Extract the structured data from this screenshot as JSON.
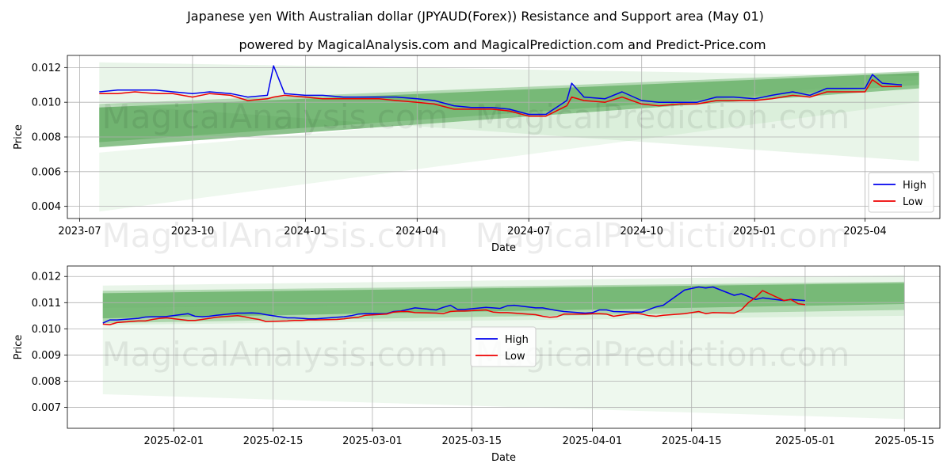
{
  "title": "Japanese yen With Australian dollar (JPYAUD(Forex)) Resistance and Support area (May 01)",
  "subtitle": "powered by MagicalAnalysis.com and MagicalPrediction.com and Predict-Price.com",
  "watermarks": [
    "MagicalAnalysis.com",
    "MagicalPrediction.com"
  ],
  "colors": {
    "high": "#0000ee",
    "low": "#ee0000",
    "band_dark": "#3f9a3f",
    "band_light": "#8fcf8f",
    "grid": "#b0b0b0"
  },
  "chart_data": [
    {
      "type": "line",
      "xlabel": "Date",
      "ylabel": "Price",
      "x_start": "2023-07-17",
      "x_end": "2025-05-15",
      "xlim": [
        "2023-06-21",
        "2025-06-01"
      ],
      "ylim": [
        0.0033,
        0.0127
      ],
      "xticks": [
        "2023-07",
        "2023-10",
        "2024-01",
        "2024-04",
        "2024-07",
        "2024-10",
        "2025-01",
        "2025-04"
      ],
      "yticks": [
        "0.004",
        "0.006",
        "0.008",
        "0.010",
        "0.012"
      ],
      "legend": [
        "High",
        "Low"
      ],
      "legend_position": "lower-right",
      "grid": true,
      "series": [
        {
          "name": "High",
          "x": [
            "2023-07-17",
            "2023-08-01",
            "2023-08-15",
            "2023-09-01",
            "2023-09-15",
            "2023-10-01",
            "2023-10-15",
            "2023-11-01",
            "2023-11-15",
            "2023-12-01",
            "2023-12-06",
            "2023-12-15",
            "2024-01-01",
            "2024-01-15",
            "2024-02-01",
            "2024-02-15",
            "2024-03-01",
            "2024-03-15",
            "2024-04-01",
            "2024-04-15",
            "2024-05-01",
            "2024-05-15",
            "2024-06-01",
            "2024-06-15",
            "2024-07-01",
            "2024-07-15",
            "2024-08-01",
            "2024-08-05",
            "2024-08-15",
            "2024-09-01",
            "2024-09-15",
            "2024-10-01",
            "2024-10-15",
            "2024-11-01",
            "2024-11-15",
            "2024-12-01",
            "2024-12-15",
            "2025-01-01",
            "2025-01-15",
            "2025-02-01",
            "2025-02-15",
            "2025-03-01",
            "2025-03-15",
            "2025-04-01",
            "2025-04-07",
            "2025-04-15",
            "2025-05-01"
          ],
          "values": [
            0.0106,
            0.0107,
            0.0107,
            0.0107,
            0.0106,
            0.0105,
            0.0106,
            0.0105,
            0.0103,
            0.0104,
            0.0121,
            0.0105,
            0.0104,
            0.0104,
            0.0103,
            0.0103,
            0.0103,
            0.0103,
            0.0102,
            0.0101,
            0.0098,
            0.0097,
            0.0097,
            0.0096,
            0.0093,
            0.0093,
            0.0101,
            0.0111,
            0.0103,
            0.0102,
            0.0106,
            0.0101,
            0.01,
            0.01,
            0.01,
            0.0103,
            0.0103,
            0.0102,
            0.0104,
            0.0106,
            0.0104,
            0.0108,
            0.0108,
            0.0108,
            0.0116,
            0.0111,
            0.011
          ]
        },
        {
          "name": "Low",
          "x": [
            "2023-07-17",
            "2023-08-01",
            "2023-08-15",
            "2023-09-01",
            "2023-09-15",
            "2023-10-01",
            "2023-10-15",
            "2023-11-01",
            "2023-11-15",
            "2023-12-01",
            "2023-12-06",
            "2023-12-15",
            "2024-01-01",
            "2024-01-15",
            "2024-02-01",
            "2024-02-15",
            "2024-03-01",
            "2024-03-15",
            "2024-04-01",
            "2024-04-15",
            "2024-05-01",
            "2024-05-15",
            "2024-06-01",
            "2024-06-15",
            "2024-07-01",
            "2024-07-15",
            "2024-08-01",
            "2024-08-05",
            "2024-08-15",
            "2024-09-01",
            "2024-09-15",
            "2024-10-01",
            "2024-10-15",
            "2024-11-01",
            "2024-11-15",
            "2024-12-01",
            "2024-12-15",
            "2025-01-01",
            "2025-01-15",
            "2025-02-01",
            "2025-02-15",
            "2025-03-01",
            "2025-03-15",
            "2025-04-01",
            "2025-04-07",
            "2025-04-15",
            "2025-05-01"
          ],
          "values": [
            0.0105,
            0.0105,
            0.0106,
            0.0105,
            0.0105,
            0.0103,
            0.0105,
            0.0104,
            0.0101,
            0.0102,
            0.0103,
            0.0104,
            0.0103,
            0.0102,
            0.0102,
            0.0102,
            0.0102,
            0.0101,
            0.01,
            0.0099,
            0.0096,
            0.0096,
            0.0096,
            0.0095,
            0.0092,
            0.0092,
            0.0098,
            0.0103,
            0.0101,
            0.01,
            0.0103,
            0.0099,
            0.0098,
            0.0099,
            0.0099,
            0.0101,
            0.0101,
            0.0101,
            0.0102,
            0.0104,
            0.0103,
            0.0106,
            0.0106,
            0.0106,
            0.0113,
            0.0109,
            0.0109
          ]
        }
      ],
      "bands": [
        {
          "opacity": 0.6,
          "x": [
            "2023-07-17",
            "2025-05-15"
          ],
          "upper": [
            0.0097,
            0.0117
          ],
          "lower": [
            0.0074,
            0.0108
          ]
        },
        {
          "opacity": 0.35,
          "x": [
            "2023-07-17",
            "2025-05-15"
          ],
          "upper": [
            0.0099,
            0.0118
          ],
          "lower": [
            0.0077,
            0.011
          ]
        },
        {
          "opacity": 0.2,
          "x": [
            "2023-07-17",
            "2025-05-15"
          ],
          "upper": [
            0.0123,
            0.0115
          ],
          "lower": [
            0.0099,
            0.0066
          ]
        },
        {
          "opacity": 0.15,
          "x": [
            "2023-07-17",
            "2025-05-15"
          ],
          "upper": [
            0.0071,
            0.0113
          ],
          "lower": [
            0.0037,
            0.01
          ]
        }
      ]
    },
    {
      "type": "line",
      "xlabel": "Date",
      "ylabel": "Price",
      "x_start": "2025-01-22",
      "x_end": "2025-05-15",
      "xlim": [
        "2025-01-17",
        "2025-05-20"
      ],
      "ylim": [
        0.0062,
        0.0124
      ],
      "xticks": [
        "2025-02-01",
        "2025-02-15",
        "2025-03-01",
        "2025-03-15",
        "2025-04-01",
        "2025-04-15",
        "2025-05-01",
        "2025-05-15"
      ],
      "yticks": [
        "0.007",
        "0.008",
        "0.009",
        "0.010",
        "0.011",
        "0.012"
      ],
      "legend": [
        "High",
        "Low"
      ],
      "legend_position": "center",
      "grid": true,
      "series": [
        {
          "name": "High",
          "x": [
            "2025-01-22",
            "2025-01-23",
            "2025-01-24",
            "2025-01-27",
            "2025-01-28",
            "2025-01-29",
            "2025-01-30",
            "2025-01-31",
            "2025-02-03",
            "2025-02-04",
            "2025-02-05",
            "2025-02-06",
            "2025-02-07",
            "2025-02-10",
            "2025-02-11",
            "2025-02-12",
            "2025-02-13",
            "2025-02-14",
            "2025-02-17",
            "2025-02-18",
            "2025-02-19",
            "2025-02-20",
            "2025-02-21",
            "2025-02-24",
            "2025-02-25",
            "2025-02-26",
            "2025-02-27",
            "2025-02-28",
            "2025-03-03",
            "2025-03-04",
            "2025-03-05",
            "2025-03-06",
            "2025-03-07",
            "2025-03-10",
            "2025-03-11",
            "2025-03-12",
            "2025-03-13",
            "2025-03-14",
            "2025-03-17",
            "2025-03-18",
            "2025-03-19",
            "2025-03-20",
            "2025-03-21",
            "2025-03-24",
            "2025-03-25",
            "2025-03-26",
            "2025-03-27",
            "2025-03-28",
            "2025-03-31",
            "2025-04-01",
            "2025-04-02",
            "2025-04-03",
            "2025-04-04",
            "2025-04-07",
            "2025-04-08",
            "2025-04-09",
            "2025-04-10",
            "2025-04-11",
            "2025-04-14",
            "2025-04-15",
            "2025-04-16",
            "2025-04-17",
            "2025-04-18",
            "2025-04-21",
            "2025-04-22",
            "2025-04-23",
            "2025-04-24",
            "2025-04-25",
            "2025-04-28",
            "2025-04-29",
            "2025-04-30",
            "2025-05-01"
          ],
          "values": [
            0.01022,
            0.01034,
            0.01034,
            0.0104,
            0.01045,
            0.01046,
            0.01046,
            0.01047,
            0.01058,
            0.01048,
            0.01046,
            0.01048,
            0.01052,
            0.0106,
            0.0106,
            0.01061,
            0.01059,
            0.01054,
            0.01042,
            0.01042,
            0.0104,
            0.01038,
            0.01038,
            0.01044,
            0.01046,
            0.0105,
            0.01056,
            0.01058,
            0.01058,
            0.01066,
            0.01068,
            0.01074,
            0.0108,
            0.01072,
            0.01082,
            0.0109,
            0.01074,
            0.01074,
            0.01082,
            0.0108,
            0.01078,
            0.01088,
            0.0109,
            0.0108,
            0.0108,
            0.01075,
            0.0107,
            0.01066,
            0.0106,
            0.01062,
            0.01072,
            0.01072,
            0.01066,
            0.01064,
            0.01064,
            0.01074,
            0.01084,
            0.0109,
            0.01148,
            0.01154,
            0.0116,
            0.01156,
            0.0116,
            0.01128,
            0.01134,
            0.01124,
            0.01112,
            0.01118,
            0.01108,
            0.01112,
            0.0111,
            0.01108
          ]
        },
        {
          "name": "Low",
          "x": [
            "2025-01-22",
            "2025-01-23",
            "2025-01-24",
            "2025-01-27",
            "2025-01-28",
            "2025-01-29",
            "2025-01-30",
            "2025-01-31",
            "2025-02-03",
            "2025-02-04",
            "2025-02-05",
            "2025-02-06",
            "2025-02-07",
            "2025-02-10",
            "2025-02-11",
            "2025-02-12",
            "2025-02-13",
            "2025-02-14",
            "2025-02-17",
            "2025-02-18",
            "2025-02-19",
            "2025-02-20",
            "2025-02-21",
            "2025-02-24",
            "2025-02-25",
            "2025-02-26",
            "2025-02-27",
            "2025-02-28",
            "2025-03-03",
            "2025-03-04",
            "2025-03-05",
            "2025-03-06",
            "2025-03-07",
            "2025-03-10",
            "2025-03-11",
            "2025-03-12",
            "2025-03-13",
            "2025-03-14",
            "2025-03-17",
            "2025-03-18",
            "2025-03-19",
            "2025-03-20",
            "2025-03-21",
            "2025-03-24",
            "2025-03-25",
            "2025-03-26",
            "2025-03-27",
            "2025-03-28",
            "2025-03-31",
            "2025-04-01",
            "2025-04-02",
            "2025-04-03",
            "2025-04-04",
            "2025-04-07",
            "2025-04-08",
            "2025-04-09",
            "2025-04-10",
            "2025-04-11",
            "2025-04-14",
            "2025-04-15",
            "2025-04-16",
            "2025-04-17",
            "2025-04-18",
            "2025-04-21",
            "2025-04-22",
            "2025-04-23",
            "2025-04-24",
            "2025-04-25",
            "2025-04-28",
            "2025-04-29",
            "2025-04-30",
            "2025-05-01"
          ],
          "values": [
            0.01018,
            0.01016,
            0.01024,
            0.0103,
            0.0103,
            0.01036,
            0.0104,
            0.01042,
            0.01032,
            0.01032,
            0.01036,
            0.0104,
            0.01044,
            0.0105,
            0.01046,
            0.0104,
            0.01036,
            0.01028,
            0.0103,
            0.01032,
            0.01032,
            0.01034,
            0.01034,
            0.01036,
            0.01038,
            0.01042,
            0.01044,
            0.01052,
            0.01056,
            0.01064,
            0.01066,
            0.01066,
            0.01062,
            0.0106,
            0.01058,
            0.01066,
            0.01068,
            0.01068,
            0.01072,
            0.01064,
            0.01062,
            0.01062,
            0.0106,
            0.01054,
            0.01048,
            0.01044,
            0.01046,
            0.01056,
            0.01056,
            0.01058,
            0.01058,
            0.01056,
            0.01048,
            0.0106,
            0.01056,
            0.0105,
            0.01048,
            0.01052,
            0.01058,
            0.01062,
            0.01066,
            0.01058,
            0.01062,
            0.0106,
            0.01072,
            0.011,
            0.0112,
            0.01146,
            0.01108,
            0.01112,
            0.01096,
            0.01092
          ]
        }
      ],
      "bands": [
        {
          "opacity": 0.6,
          "x": [
            "2025-01-22",
            "2025-05-15"
          ],
          "upper": [
            0.01136,
            0.01175
          ],
          "lower": [
            0.0104,
            0.01095
          ]
        },
        {
          "opacity": 0.35,
          "x": [
            "2025-01-22",
            "2025-05-15"
          ],
          "upper": [
            0.01145,
            0.0118
          ],
          "lower": [
            0.01022,
            0.01072
          ]
        },
        {
          "opacity": 0.2,
          "x": [
            "2025-01-22",
            "2025-05-15"
          ],
          "upper": [
            0.01165,
            0.01205
          ],
          "lower": [
            0.01015,
            0.0105
          ]
        },
        {
          "opacity": 0.15,
          "x": [
            "2025-01-22",
            "2025-05-15"
          ],
          "upper": [
            0.0108,
            0.01108
          ],
          "lower": [
            0.0075,
            0.00655
          ]
        }
      ]
    }
  ]
}
